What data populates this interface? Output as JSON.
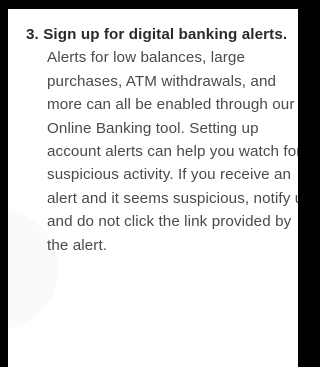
{
  "tip": {
    "number": "3.",
    "heading": "Sign up for digital banking alerts.",
    "body": "Alerts for low balances, large purchases, ATM withdrawals, and more can all be enabled through our Online Banking tool. Setting up account alerts can help you watch for suspicious activity. If you receive an alert and it seems suspicious, notify us and do not click the link provided by the alert."
  }
}
